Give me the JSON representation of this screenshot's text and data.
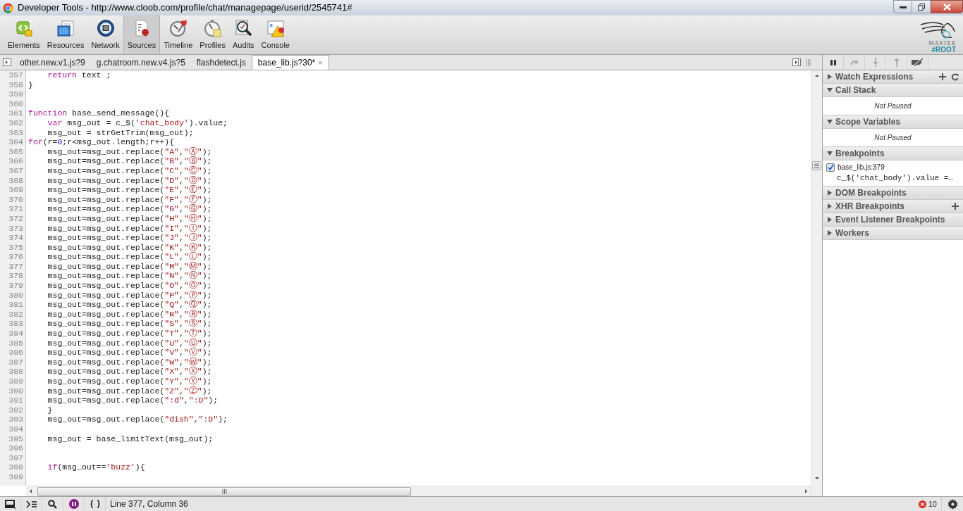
{
  "window": {
    "title": "Developer Tools - http://www.cloob.com/profile/chat/managepage/userid/2545741#"
  },
  "panels": [
    {
      "label": "Elements",
      "selected": false
    },
    {
      "label": "Resources",
      "selected": false
    },
    {
      "label": "Network",
      "selected": false
    },
    {
      "label": "Sources",
      "selected": true
    },
    {
      "label": "Timeline",
      "selected": false
    },
    {
      "label": "Profiles",
      "selected": false
    },
    {
      "label": "Audits",
      "selected": false
    },
    {
      "label": "Console",
      "selected": false
    }
  ],
  "logo": [
    "MASTER",
    "#ROOT"
  ],
  "file_tabs": [
    {
      "label": "other.new.v1.js?9",
      "selected": false
    },
    {
      "label": "g.chatroom.new.v4.js?5",
      "selected": false
    },
    {
      "label": "flashdetect.js",
      "selected": false
    },
    {
      "label": "base_lib.js?30*",
      "selected": true,
      "close": "×"
    }
  ],
  "code_lines": [
    {
      "number": "357",
      "indented": true,
      "tokens": [
        {
          "kind": "keyword",
          "text": "return"
        },
        {
          "kind": "plain",
          "text": " text ;"
        }
      ]
    },
    {
      "number": "358",
      "indented": false,
      "tokens": [
        {
          "kind": "plain",
          "text": "}"
        }
      ]
    },
    {
      "number": "359"
    },
    {
      "number": "360"
    },
    {
      "number": "361",
      "indented": false,
      "tokens": [
        {
          "kind": "keyword",
          "text": "function"
        },
        {
          "kind": "plain",
          "text": " base_send_message(){"
        }
      ]
    },
    {
      "number": "362",
      "indented": true,
      "tokens": [
        {
          "kind": "keyword",
          "text": "var"
        },
        {
          "kind": "plain",
          "text": " msg_out = c_$("
        },
        {
          "kind": "string",
          "text": "'chat_body'"
        },
        {
          "kind": "plain",
          "text": ").value;"
        }
      ]
    },
    {
      "number": "363",
      "indented": true,
      "tokens": [
        {
          "kind": "plain",
          "text": "msg_out = strGetTrim(msg_out);"
        }
      ]
    },
    {
      "number": "364",
      "indented": false,
      "tokens": [
        {
          "kind": "keyword",
          "text": "for"
        },
        {
          "kind": "plain",
          "text": "(r="
        },
        {
          "kind": "number",
          "text": "0"
        },
        {
          "kind": "plain",
          "text": ";r<msg_out.length;r++){"
        }
      ]
    },
    {
      "number": "365",
      "indented": true,
      "tokens": [
        {
          "kind": "plain",
          "text": "msg_out=msg_out.replace("
        },
        {
          "kind": "string",
          "text": "\"A\""
        },
        {
          "kind": "plain",
          "text": ","
        },
        {
          "kind": "string",
          "text": "\"Ⓐ\""
        },
        {
          "kind": "plain",
          "text": ");"
        }
      ]
    },
    {
      "number": "366",
      "indented": true,
      "tokens": [
        {
          "kind": "plain",
          "text": "msg_out=msg_out.replace("
        },
        {
          "kind": "string",
          "text": "\"B\""
        },
        {
          "kind": "plain",
          "text": ","
        },
        {
          "kind": "string",
          "text": "\"Ⓑ\""
        },
        {
          "kind": "plain",
          "text": ");"
        }
      ]
    },
    {
      "number": "367",
      "indented": true,
      "tokens": [
        {
          "kind": "plain",
          "text": "msg_out=msg_out.replace("
        },
        {
          "kind": "string",
          "text": "\"C\""
        },
        {
          "kind": "plain",
          "text": ","
        },
        {
          "kind": "string",
          "text": "\"Ⓒ\""
        },
        {
          "kind": "plain",
          "text": ");"
        }
      ]
    },
    {
      "number": "368",
      "indented": true,
      "tokens": [
        {
          "kind": "plain",
          "text": "msg_out=msg_out.replace("
        },
        {
          "kind": "string",
          "text": "\"D\""
        },
        {
          "kind": "plain",
          "text": ","
        },
        {
          "kind": "string",
          "text": "\"Ⓓ\""
        },
        {
          "kind": "plain",
          "text": ");"
        }
      ]
    },
    {
      "number": "369",
      "indented": true,
      "tokens": [
        {
          "kind": "plain",
          "text": "msg_out=msg_out.replace("
        },
        {
          "kind": "string",
          "text": "\"E\""
        },
        {
          "kind": "plain",
          "text": ","
        },
        {
          "kind": "string",
          "text": "\"Ⓔ\""
        },
        {
          "kind": "plain",
          "text": ");"
        }
      ]
    },
    {
      "number": "370",
      "indented": true,
      "tokens": [
        {
          "kind": "plain",
          "text": "msg_out=msg_out.replace("
        },
        {
          "kind": "string",
          "text": "\"F\""
        },
        {
          "kind": "plain",
          "text": ","
        },
        {
          "kind": "string",
          "text": "\"Ⓕ\""
        },
        {
          "kind": "plain",
          "text": ");"
        }
      ]
    },
    {
      "number": "371",
      "indented": true,
      "tokens": [
        {
          "kind": "plain",
          "text": "msg_out=msg_out.replace("
        },
        {
          "kind": "string",
          "text": "\"G\""
        },
        {
          "kind": "plain",
          "text": ","
        },
        {
          "kind": "string",
          "text": "\"Ⓖ\""
        },
        {
          "kind": "plain",
          "text": ");"
        }
      ]
    },
    {
      "number": "372",
      "indented": true,
      "tokens": [
        {
          "kind": "plain",
          "text": "msg_out=msg_out.replace("
        },
        {
          "kind": "string",
          "text": "\"H\""
        },
        {
          "kind": "plain",
          "text": ","
        },
        {
          "kind": "string",
          "text": "\"Ⓗ\""
        },
        {
          "kind": "plain",
          "text": ");"
        }
      ]
    },
    {
      "number": "373",
      "indented": true,
      "tokens": [
        {
          "kind": "plain",
          "text": "msg_out=msg_out.replace("
        },
        {
          "kind": "string",
          "text": "\"I\""
        },
        {
          "kind": "plain",
          "text": ","
        },
        {
          "kind": "string",
          "text": "\"Ⓘ\""
        },
        {
          "kind": "plain",
          "text": ");"
        }
      ]
    },
    {
      "number": "374",
      "indented": true,
      "tokens": [
        {
          "kind": "plain",
          "text": "msg_out=msg_out.replace("
        },
        {
          "kind": "string",
          "text": "\"J\""
        },
        {
          "kind": "plain",
          "text": ","
        },
        {
          "kind": "string",
          "text": "\"Ⓙ\""
        },
        {
          "kind": "plain",
          "text": ");"
        }
      ]
    },
    {
      "number": "375",
      "indented": true,
      "tokens": [
        {
          "kind": "plain",
          "text": "msg_out=msg_out.replace("
        },
        {
          "kind": "string",
          "text": "\"K\""
        },
        {
          "kind": "plain",
          "text": ","
        },
        {
          "kind": "string",
          "text": "\"Ⓚ\""
        },
        {
          "kind": "plain",
          "text": ");"
        }
      ]
    },
    {
      "number": "376",
      "indented": true,
      "tokens": [
        {
          "kind": "plain",
          "text": "msg_out=msg_out.replace("
        },
        {
          "kind": "string",
          "text": "\"L\""
        },
        {
          "kind": "plain",
          "text": ","
        },
        {
          "kind": "string",
          "text": "\"Ⓛ\""
        },
        {
          "kind": "plain",
          "text": ");"
        }
      ]
    },
    {
      "number": "377",
      "indented": true,
      "tokens": [
        {
          "kind": "plain",
          "text": "msg_out=msg_out.replace("
        },
        {
          "kind": "string",
          "text": "\"M\""
        },
        {
          "kind": "plain",
          "text": ","
        },
        {
          "kind": "string",
          "text": "\"Ⓜ\""
        },
        {
          "kind": "plain",
          "text": ");"
        }
      ]
    },
    {
      "number": "378",
      "indented": true,
      "tokens": [
        {
          "kind": "plain",
          "text": "msg_out=msg_out.replace("
        },
        {
          "kind": "string",
          "text": "\"N\""
        },
        {
          "kind": "plain",
          "text": ","
        },
        {
          "kind": "string",
          "text": "\"Ⓝ\""
        },
        {
          "kind": "plain",
          "text": ");"
        }
      ]
    },
    {
      "number": "379",
      "indented": true,
      "tokens": [
        {
          "kind": "plain",
          "text": "msg_out=msg_out.replace("
        },
        {
          "kind": "string",
          "text": "\"O\""
        },
        {
          "kind": "plain",
          "text": ","
        },
        {
          "kind": "string",
          "text": "\"Ⓞ\""
        },
        {
          "kind": "plain",
          "text": ");"
        }
      ]
    },
    {
      "number": "380",
      "indented": true,
      "tokens": [
        {
          "kind": "plain",
          "text": "msg_out=msg_out.replace("
        },
        {
          "kind": "string",
          "text": "\"P\""
        },
        {
          "kind": "plain",
          "text": ","
        },
        {
          "kind": "string",
          "text": "\"Ⓟ\""
        },
        {
          "kind": "plain",
          "text": ");"
        }
      ]
    },
    {
      "number": "381",
      "indented": true,
      "tokens": [
        {
          "kind": "plain",
          "text": "msg_out=msg_out.replace("
        },
        {
          "kind": "string",
          "text": "\"Q\""
        },
        {
          "kind": "plain",
          "text": ","
        },
        {
          "kind": "string",
          "text": "\"Ⓠ\""
        },
        {
          "kind": "plain",
          "text": ");"
        }
      ]
    },
    {
      "number": "382",
      "indented": true,
      "tokens": [
        {
          "kind": "plain",
          "text": "msg_out=msg_out.replace("
        },
        {
          "kind": "string",
          "text": "\"R\""
        },
        {
          "kind": "plain",
          "text": ","
        },
        {
          "kind": "string",
          "text": "\"Ⓡ\""
        },
        {
          "kind": "plain",
          "text": ");"
        }
      ]
    },
    {
      "number": "383",
      "indented": true,
      "tokens": [
        {
          "kind": "plain",
          "text": "msg_out=msg_out.replace("
        },
        {
          "kind": "string",
          "text": "\"S\""
        },
        {
          "kind": "plain",
          "text": ","
        },
        {
          "kind": "string",
          "text": "\"Ⓢ\""
        },
        {
          "kind": "plain",
          "text": ");"
        }
      ]
    },
    {
      "number": "384",
      "indented": true,
      "tokens": [
        {
          "kind": "plain",
          "text": "msg_out=msg_out.replace("
        },
        {
          "kind": "string",
          "text": "\"T\""
        },
        {
          "kind": "plain",
          "text": ","
        },
        {
          "kind": "string",
          "text": "\"Ⓣ\""
        },
        {
          "kind": "plain",
          "text": ");"
        }
      ]
    },
    {
      "number": "385",
      "indented": true,
      "tokens": [
        {
          "kind": "plain",
          "text": "msg_out=msg_out.replace("
        },
        {
          "kind": "string",
          "text": "\"U\""
        },
        {
          "kind": "plain",
          "text": ","
        },
        {
          "kind": "string",
          "text": "\"Ⓤ\""
        },
        {
          "kind": "plain",
          "text": ");"
        }
      ]
    },
    {
      "number": "386",
      "indented": true,
      "tokens": [
        {
          "kind": "plain",
          "text": "msg_out=msg_out.replace("
        },
        {
          "kind": "string",
          "text": "\"V\""
        },
        {
          "kind": "plain",
          "text": ","
        },
        {
          "kind": "string",
          "text": "\"Ⓥ\""
        },
        {
          "kind": "plain",
          "text": ");"
        }
      ]
    },
    {
      "number": "387",
      "indented": true,
      "tokens": [
        {
          "kind": "plain",
          "text": "msg_out=msg_out.replace("
        },
        {
          "kind": "string",
          "text": "\"W\""
        },
        {
          "kind": "plain",
          "text": ","
        },
        {
          "kind": "string",
          "text": "\"Ⓦ\""
        },
        {
          "kind": "plain",
          "text": ");"
        }
      ]
    },
    {
      "number": "388",
      "indented": true,
      "tokens": [
        {
          "kind": "plain",
          "text": "msg_out=msg_out.replace("
        },
        {
          "kind": "string",
          "text": "\"X\""
        },
        {
          "kind": "plain",
          "text": ","
        },
        {
          "kind": "string",
          "text": "\"Ⓧ\""
        },
        {
          "kind": "plain",
          "text": ");"
        }
      ]
    },
    {
      "number": "389",
      "indented": true,
      "tokens": [
        {
          "kind": "plain",
          "text": "msg_out=msg_out.replace("
        },
        {
          "kind": "string",
          "text": "\"Y\""
        },
        {
          "kind": "plain",
          "text": ","
        },
        {
          "kind": "string",
          "text": "\"Ⓨ\""
        },
        {
          "kind": "plain",
          "text": ");"
        }
      ]
    },
    {
      "number": "390",
      "indented": true,
      "tokens": [
        {
          "kind": "plain",
          "text": "msg_out=msg_out.replace("
        },
        {
          "kind": "string",
          "text": "\"Z\""
        },
        {
          "kind": "plain",
          "text": ","
        },
        {
          "kind": "string",
          "text": "\"Ⓩ\""
        },
        {
          "kind": "plain",
          "text": ");"
        }
      ]
    },
    {
      "number": "391",
      "indented": true,
      "tokens": [
        {
          "kind": "plain",
          "text": "msg_out=msg_out.replace("
        },
        {
          "kind": "string",
          "text": "\":d\""
        },
        {
          "kind": "plain",
          "text": ","
        },
        {
          "kind": "string",
          "text": "\":D\""
        },
        {
          "kind": "plain",
          "text": ");"
        }
      ]
    },
    {
      "number": "392",
      "indented": true,
      "tokens": [
        {
          "kind": "plain",
          "text": "}"
        }
      ]
    },
    {
      "number": "393",
      "indented": true,
      "tokens": [
        {
          "kind": "plain",
          "text": "msg_out=msg_out.replace("
        },
        {
          "kind": "string",
          "text": "\"dish\""
        },
        {
          "kind": "plain",
          "text": ","
        },
        {
          "kind": "string",
          "text": "\":D\""
        },
        {
          "kind": "plain",
          "text": ");"
        }
      ]
    },
    {
      "number": "394"
    },
    {
      "number": "395",
      "indented": true,
      "tokens": [
        {
          "kind": "plain",
          "text": "msg_out = base_limitText(msg_out);"
        }
      ]
    },
    {
      "number": "396"
    },
    {
      "number": "397"
    },
    {
      "number": "398",
      "indented": true,
      "tokens": [
        {
          "kind": "keyword",
          "text": "if"
        },
        {
          "kind": "plain",
          "text": "(msg_out=="
        },
        {
          "kind": "string",
          "text": "'buzz'"
        },
        {
          "kind": "plain",
          "text": "){"
        }
      ]
    },
    {
      "number": "399"
    }
  ],
  "sidebar": {
    "sections": [
      {
        "title": "Watch Expressions",
        "expanded": false,
        "add": true,
        "refresh": true
      },
      {
        "title": "Call Stack",
        "expanded": true,
        "message": "Not Paused"
      },
      {
        "title": "Scope Variables",
        "expanded": true,
        "message": "Not Paused"
      },
      {
        "title": "Breakpoints",
        "expanded": true,
        "breakpoints": [
          {
            "location": "base_lib.js:379",
            "snippet": "c_$('chat_body').value =…",
            "checked": true
          }
        ]
      },
      {
        "title": "DOM Breakpoints",
        "expanded": false
      },
      {
        "title": "XHR Breakpoints",
        "expanded": false,
        "add": true
      },
      {
        "title": "Event Listener Breakpoints",
        "expanded": false
      },
      {
        "title": "Workers",
        "expanded": false
      }
    ]
  },
  "status_bar": {
    "cursor": "Line 377, Column 36",
    "error_count": "10"
  }
}
